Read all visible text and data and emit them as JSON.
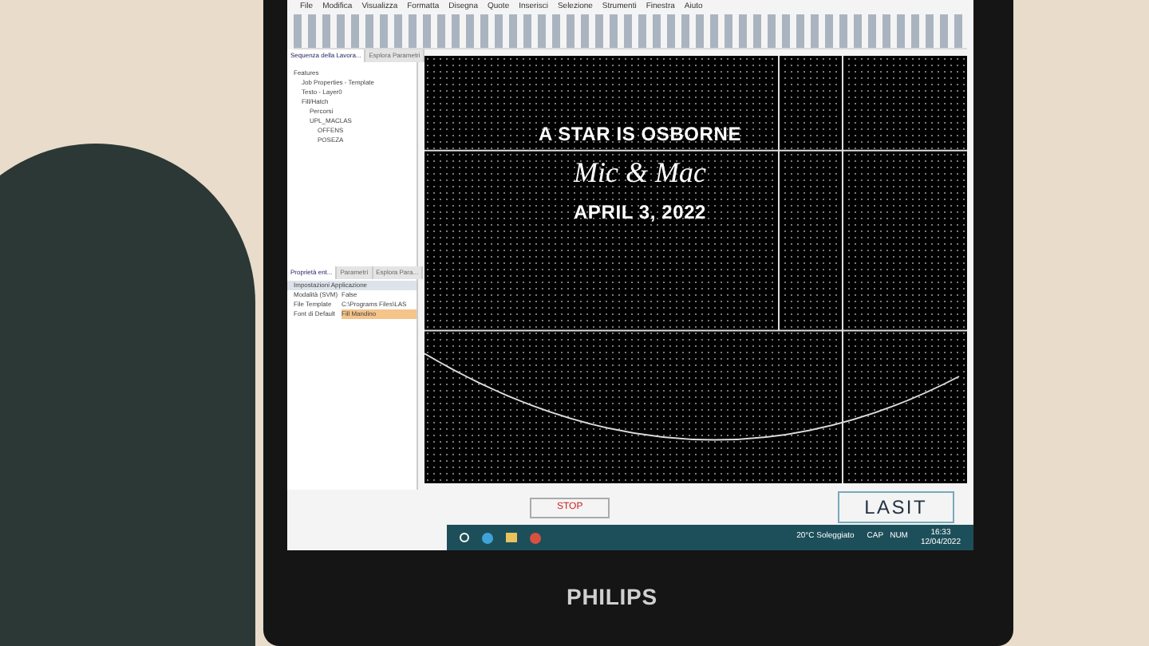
{
  "menu_bar": {
    "items": [
      "File",
      "Modifica",
      "Visualizza",
      "Formatta",
      "Disegna",
      "Quote",
      "Inserisci",
      "Selezione",
      "Strumenti",
      "Finestra",
      "Aiuto"
    ]
  },
  "left_panel": {
    "tabs": [
      {
        "label": "Sequenza della Lavora...",
        "selected": true
      },
      {
        "label": "Esplora Parametri",
        "selected": false
      }
    ],
    "tree": [
      {
        "label": "Features",
        "children": [
          {
            "label": "Job Properties - Template"
          },
          {
            "label": "Testo - Layer0"
          },
          {
            "label": "Fill/Hatch",
            "children": [
              {
                "label": "Percorsi"
              },
              {
                "label": "UPL_MACLAS",
                "children": [
                  {
                    "label": "OFFENS"
                  },
                  {
                    "label": "POSEZA"
                  }
                ]
              }
            ]
          }
        ]
      }
    ]
  },
  "properties_panel": {
    "tabs": [
      {
        "label": "Proprietà ent...",
        "selected": true
      },
      {
        "label": "Parametri",
        "selected": false
      },
      {
        "label": "Esplora Para...",
        "selected": false
      }
    ],
    "heading": "Impostazioni Applicazione",
    "rows": [
      {
        "name": "Modalità (SVM)",
        "value": "False",
        "highlight": false
      },
      {
        "name": "File Template",
        "value": "C:\\Programs Files\\LAS",
        "highlight": false
      },
      {
        "name": "Font di Default",
        "value": "Fill Mandino",
        "highlight": true
      }
    ]
  },
  "canvas": {
    "lines": [
      {
        "kind": "plain",
        "text": "A STAR IS OSBORNE"
      },
      {
        "kind": "script",
        "text": "Mic & Mac"
      },
      {
        "kind": "plain",
        "text": "APRIL 3, 2022"
      }
    ]
  },
  "controls": {
    "stop_button": "STOP",
    "logo": "LASIT",
    "status": [
      "CAP",
      "NUM"
    ]
  },
  "taskbar": {
    "weather": "20°C Soleggiato",
    "time": "16:33",
    "date": "12/04/2022"
  },
  "monitor": {
    "brand": "PHILIPS"
  }
}
